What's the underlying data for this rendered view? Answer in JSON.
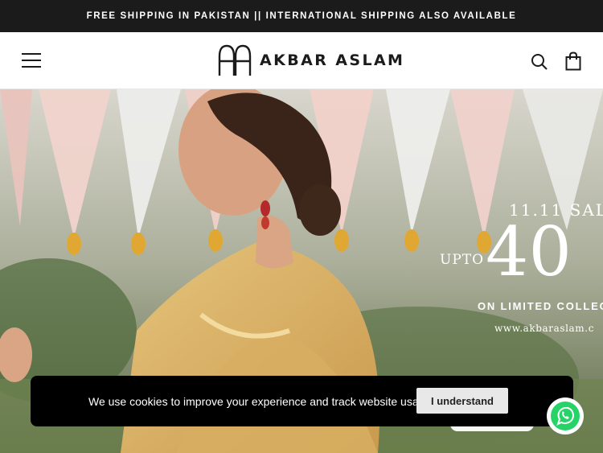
{
  "announcement": {
    "text": "FREE SHIPPING IN PAKISTAN || INTERNATIONAL SHIPPING ALSO AVAILABLE"
  },
  "header": {
    "logo_text": "AKBAR ASLAM",
    "icons": [
      "menu-icon",
      "search-icon",
      "shopping-bag-icon"
    ]
  },
  "hero": {
    "sale_title": "11.11 SAL",
    "upto": "UPTO",
    "big_number": "40",
    "sub_line": "ON LIMITED COLLEC",
    "url": "www.akbaraslam.c"
  },
  "cookie_banner": {
    "message": "We use cookies to improve your experience and track website usage.",
    "button_label": "I understand"
  },
  "colors": {
    "dark": "#1c1b1b",
    "white": "#ffffff",
    "whatsapp_green": "#25d366"
  }
}
